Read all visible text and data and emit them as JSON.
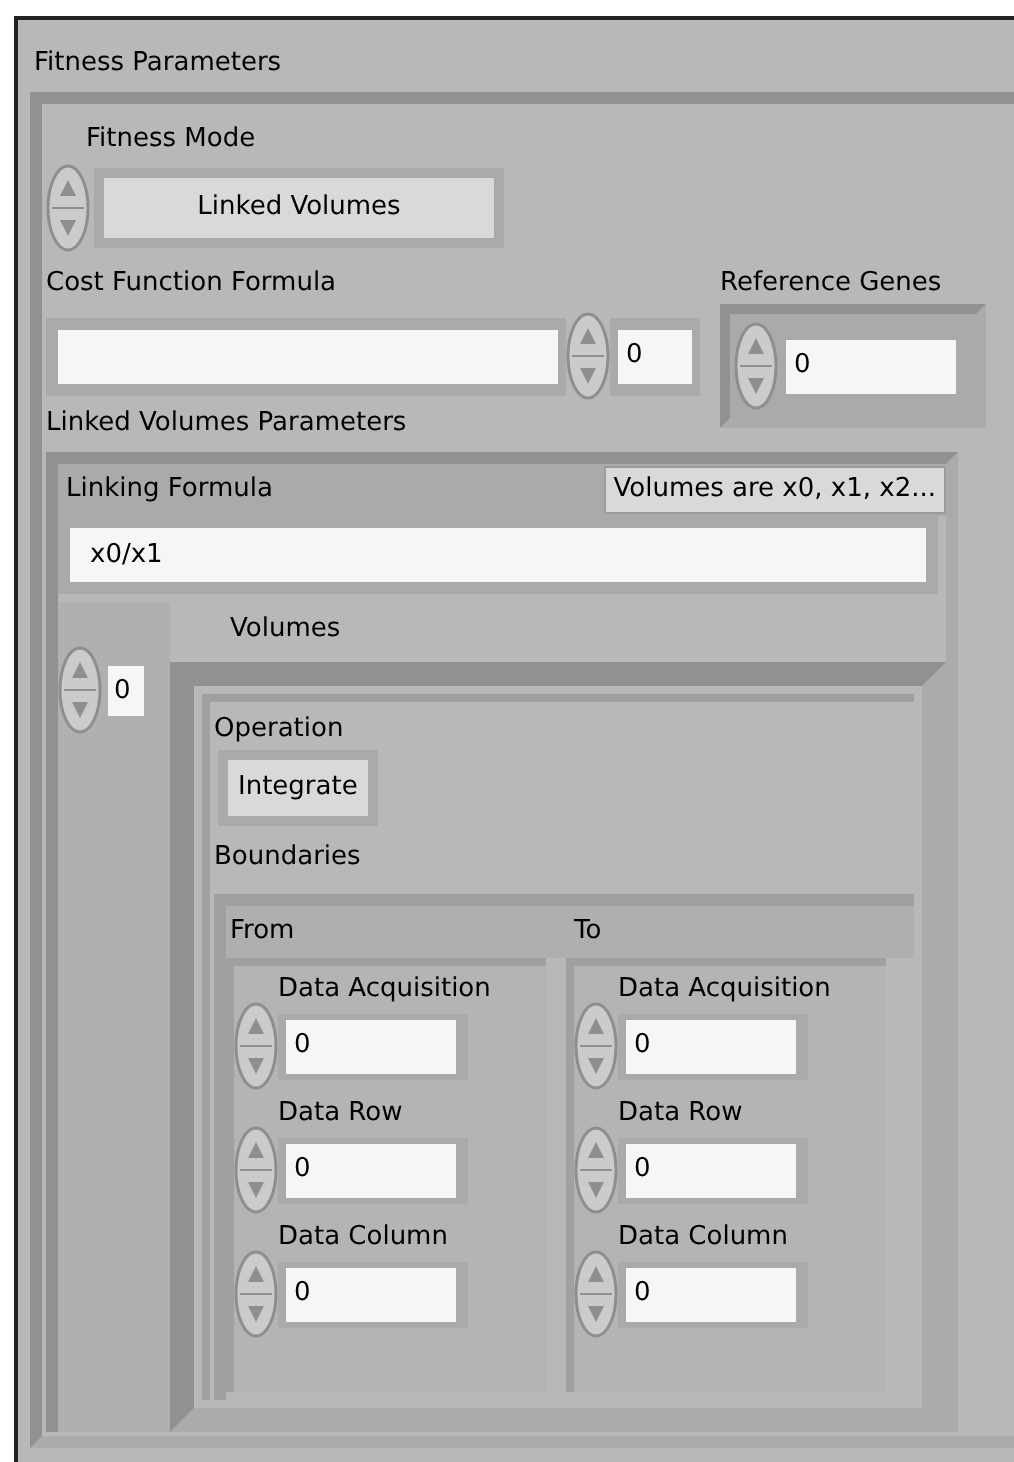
{
  "panel": {
    "title": "Fitness Parameters"
  },
  "fitness_mode": {
    "label": "Fitness Mode",
    "value": "Linked Volumes"
  },
  "cost_function_formula": {
    "label": "Cost Function Formula",
    "index": "0"
  },
  "reference_genes": {
    "label": "Reference Genes",
    "value": "0"
  },
  "linked_volumes_parameters": {
    "label": "Linked Volumes Parameters",
    "linking_formula": {
      "label": "Linking Formula",
      "button": "Volumes are x0, x1, x2...",
      "value": "x0/x1"
    },
    "volumes": {
      "label": "Volumes",
      "index": "0",
      "operation": {
        "label": "Operation",
        "value": "Integrate"
      },
      "boundaries": {
        "label": "Boundaries",
        "groups": [
          {
            "label": "From",
            "fields": [
              {
                "label": "Data Acquisition",
                "value": "0"
              },
              {
                "label": "Data Row",
                "value": "0"
              },
              {
                "label": "Data Column",
                "value": "0"
              }
            ]
          },
          {
            "label": "To",
            "fields": [
              {
                "label": "Data Acquisition",
                "value": "0"
              },
              {
                "label": "Data Row",
                "value": "0"
              },
              {
                "label": "Data Column",
                "value": "0"
              }
            ]
          }
        ]
      }
    }
  }
}
